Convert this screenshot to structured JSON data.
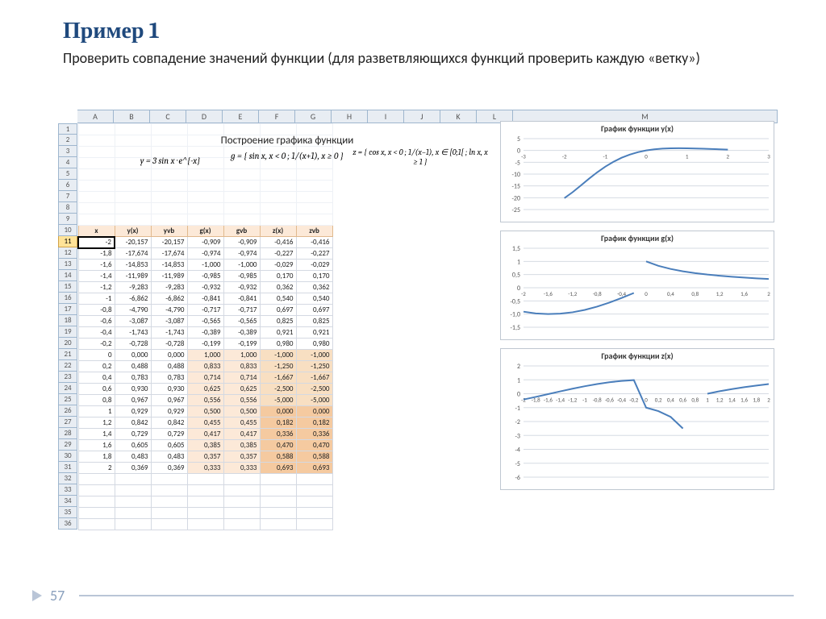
{
  "slide": {
    "title": "Пример 1",
    "subtitle": "Проверить совпадение значений функции (для разветвляющихся функций проверить каждую «ветку»)",
    "page_number": "57"
  },
  "sheet_title": "Построение графика функции",
  "columns": [
    "A",
    "B",
    "C",
    "D",
    "E",
    "F",
    "G",
    "H",
    "I",
    "J",
    "K",
    "L",
    "M"
  ],
  "row_numbers": [
    "1",
    "2",
    "3",
    "4",
    "5",
    "6",
    "7",
    "8",
    "9",
    "10",
    "11",
    "12",
    "13",
    "14",
    "15",
    "16",
    "17",
    "18",
    "19",
    "20",
    "21",
    "22",
    "23",
    "24",
    "25",
    "26",
    "27",
    "28",
    "29",
    "30",
    "31",
    "32",
    "33",
    "34",
    "35",
    "36"
  ],
  "formulas": {
    "y": "y = 3 sin x · e^{-x}",
    "g": "g = { sin x, x < 0 ;  1/(x+1), x ≥ 0 }",
    "z": "z = { cos x, x < 0 ;  1/(x−1), x ∈ [0;1[ ;  ln x, x ≥ 1 }"
  },
  "table": {
    "headers": [
      "x",
      "y(x)",
      "yvb",
      "g(x)",
      "gvb",
      "z(x)",
      "zvb"
    ],
    "rows": [
      [
        "-2",
        "-20,157",
        "-20,157",
        "-0,909",
        "-0,909",
        "-0,416",
        "-0,416"
      ],
      [
        "-1,8",
        "-17,674",
        "-17,674",
        "-0,974",
        "-0,974",
        "-0,227",
        "-0,227"
      ],
      [
        "-1,6",
        "-14,853",
        "-14,853",
        "-1,000",
        "-1,000",
        "-0,029",
        "-0,029"
      ],
      [
        "-1,4",
        "-11,989",
        "-11,989",
        "-0,985",
        "-0,985",
        "0,170",
        "0,170"
      ],
      [
        "-1,2",
        "-9,283",
        "-9,283",
        "-0,932",
        "-0,932",
        "0,362",
        "0,362"
      ],
      [
        "-1",
        "-6,862",
        "-6,862",
        "-0,841",
        "-0,841",
        "0,540",
        "0,540"
      ],
      [
        "-0,8",
        "-4,790",
        "-4,790",
        "-0,717",
        "-0,717",
        "0,697",
        "0,697"
      ],
      [
        "-0,6",
        "-3,087",
        "-3,087",
        "-0,565",
        "-0,565",
        "0,825",
        "0,825"
      ],
      [
        "-0,4",
        "-1,743",
        "-1,743",
        "-0,389",
        "-0,389",
        "0,921",
        "0,921"
      ],
      [
        "-0,2",
        "-0,728",
        "-0,728",
        "-0,199",
        "-0,199",
        "0,980",
        "0,980"
      ],
      [
        "0",
        "0,000",
        "0,000",
        "1,000",
        "1,000",
        "-1,000",
        "-1,000"
      ],
      [
        "0,2",
        "0,488",
        "0,488",
        "0,833",
        "0,833",
        "-1,250",
        "-1,250"
      ],
      [
        "0,4",
        "0,783",
        "0,783",
        "0,714",
        "0,714",
        "-1,667",
        "-1,667"
      ],
      [
        "0,6",
        "0,930",
        "0,930",
        "0,625",
        "0,625",
        "-2,500",
        "-2,500"
      ],
      [
        "0,8",
        "0,967",
        "0,967",
        "0,556",
        "0,556",
        "-5,000",
        "-5,000"
      ],
      [
        "1",
        "0,929",
        "0,929",
        "0,500",
        "0,500",
        "0,000",
        "0,000"
      ],
      [
        "1,2",
        "0,842",
        "0,842",
        "0,455",
        "0,455",
        "0,182",
        "0,182"
      ],
      [
        "1,4",
        "0,729",
        "0,729",
        "0,417",
        "0,417",
        "0,336",
        "0,336"
      ],
      [
        "1,6",
        "0,605",
        "0,605",
        "0,385",
        "0,385",
        "0,470",
        "0,470"
      ],
      [
        "1,8",
        "0,483",
        "0,483",
        "0,357",
        "0,357",
        "0,588",
        "0,588"
      ],
      [
        "2",
        "0,369",
        "0,369",
        "0,333",
        "0,333",
        "0,693",
        "0,693"
      ]
    ]
  },
  "charts": {
    "y": {
      "title": "График функции y(x)",
      "xticks": [
        "-3",
        "-2",
        "-1",
        "0",
        "1",
        "2",
        "3"
      ],
      "yticks": [
        "5",
        "0",
        "-5",
        "-10",
        "-15",
        "-20",
        "-25"
      ]
    },
    "g": {
      "title": "График функции g(x)",
      "xticks": [
        "-2",
        "-1,6",
        "-1,2",
        "-0,8",
        "-0,4",
        "0",
        "0,4",
        "0,8",
        "1,2",
        "1,6",
        "2"
      ],
      "yticks": [
        "1,5",
        "1",
        "0,5",
        "0",
        "-0,5",
        "-1,0",
        "-1,5"
      ]
    },
    "z": {
      "title": "График функции z(x)",
      "xticks": [
        "-2",
        "-1,8",
        "-1,6",
        "-1,4",
        "-1,2",
        "-1",
        "-0,8",
        "-0,6",
        "-0,4",
        "-0,2",
        "0",
        "0,2",
        "0,4",
        "0,6",
        "0,8",
        "1",
        "1,2",
        "1,4",
        "1,6",
        "1,8",
        "2"
      ],
      "yticks": [
        "2",
        "1",
        "0",
        "-1",
        "-2",
        "-3",
        "-4",
        "-5",
        "-6"
      ]
    }
  },
  "chart_data": [
    {
      "type": "line",
      "title": "График функции y(x)",
      "xlabel": "",
      "ylabel": "",
      "xlim": [
        -3,
        3
      ],
      "ylim": [
        -25,
        5
      ],
      "series": [
        {
          "name": "y(x)",
          "x": [
            -2,
            -1.8,
            -1.6,
            -1.4,
            -1.2,
            -1,
            -0.8,
            -0.6,
            -0.4,
            -0.2,
            0,
            0.2,
            0.4,
            0.6,
            0.8,
            1,
            1.2,
            1.4,
            1.6,
            1.8,
            2
          ],
          "y": [
            -20.157,
            -17.674,
            -14.853,
            -11.989,
            -9.283,
            -6.862,
            -4.79,
            -3.087,
            -1.743,
            -0.728,
            0.0,
            0.488,
            0.783,
            0.93,
            0.967,
            0.929,
            0.842,
            0.729,
            0.605,
            0.483,
            0.369
          ]
        }
      ]
    },
    {
      "type": "line",
      "title": "График функции g(x)",
      "xlabel": "",
      "ylabel": "",
      "xlim": [
        -2,
        2
      ],
      "ylim": [
        -1.5,
        1.5
      ],
      "series": [
        {
          "name": "g(x)",
          "x": [
            -2,
            -1.8,
            -1.6,
            -1.4,
            -1.2,
            -1,
            -0.8,
            -0.6,
            -0.4,
            -0.2,
            0,
            0.2,
            0.4,
            0.6,
            0.8,
            1,
            1.2,
            1.4,
            1.6,
            1.8,
            2
          ],
          "y": [
            -0.909,
            -0.974,
            -1.0,
            -0.985,
            -0.932,
            -0.841,
            -0.717,
            -0.565,
            -0.389,
            -0.199,
            1.0,
            0.833,
            0.714,
            0.625,
            0.556,
            0.5,
            0.455,
            0.417,
            0.385,
            0.357,
            0.333
          ]
        }
      ]
    },
    {
      "type": "line",
      "title": "График функции z(x)",
      "xlabel": "",
      "ylabel": "",
      "xlim": [
        -2,
        2
      ],
      "ylim": [
        -6,
        2
      ],
      "series": [
        {
          "name": "z(x)",
          "x": [
            -2,
            -1.8,
            -1.6,
            -1.4,
            -1.2,
            -1,
            -0.8,
            -0.6,
            -0.4,
            -0.2,
            0,
            0.2,
            0.4,
            0.6,
            0.8,
            1,
            1.2,
            1.4,
            1.6,
            1.8,
            2
          ],
          "y": [
            -0.416,
            -0.227,
            -0.029,
            0.17,
            0.362,
            0.54,
            0.697,
            0.825,
            0.921,
            0.98,
            -1.0,
            -1.25,
            -1.667,
            -2.5,
            -5.0,
            0.0,
            0.182,
            0.336,
            0.47,
            0.588,
            0.693
          ]
        }
      ]
    }
  ]
}
